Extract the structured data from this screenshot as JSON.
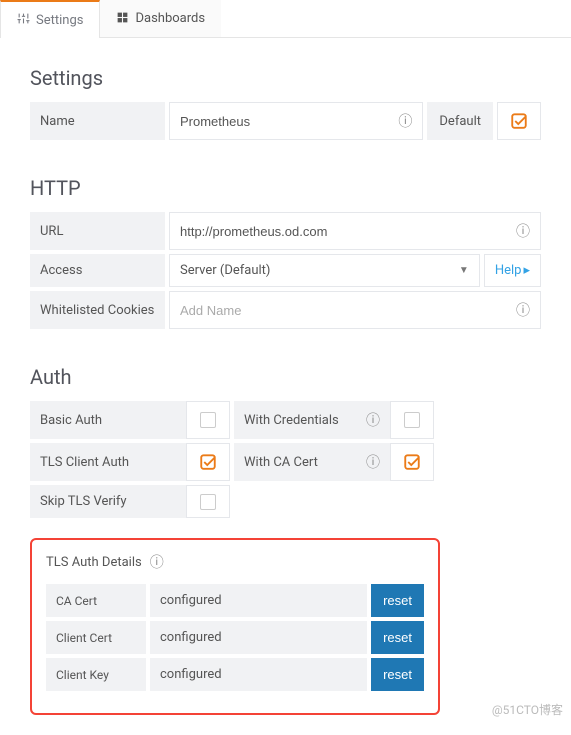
{
  "tabs": {
    "settings": "Settings",
    "dashboards": "Dashboards"
  },
  "settings": {
    "heading": "Settings",
    "name_label": "Name",
    "name_value": "Prometheus",
    "default_label": "Default"
  },
  "http": {
    "heading": "HTTP",
    "url_label": "URL",
    "url_value": "http://prometheus.od.com",
    "access_label": "Access",
    "access_value": "Server (Default)",
    "help_label": "Help",
    "cookies_label": "Whitelisted Cookies",
    "cookies_placeholder": "Add Name"
  },
  "auth": {
    "heading": "Auth",
    "basic_auth": "Basic Auth",
    "with_credentials": "With Credentials",
    "tls_client_auth": "TLS Client Auth",
    "with_ca_cert": "With CA Cert",
    "skip_tls_verify": "Skip TLS Verify"
  },
  "tls": {
    "heading": "TLS Auth Details",
    "ca_cert_label": "CA Cert",
    "ca_cert_value": "configured",
    "client_cert_label": "Client Cert",
    "client_cert_value": "configured",
    "client_key_label": "Client Key",
    "client_key_value": "configured",
    "reset_label": "reset"
  },
  "watermark": "@51CTO博客"
}
